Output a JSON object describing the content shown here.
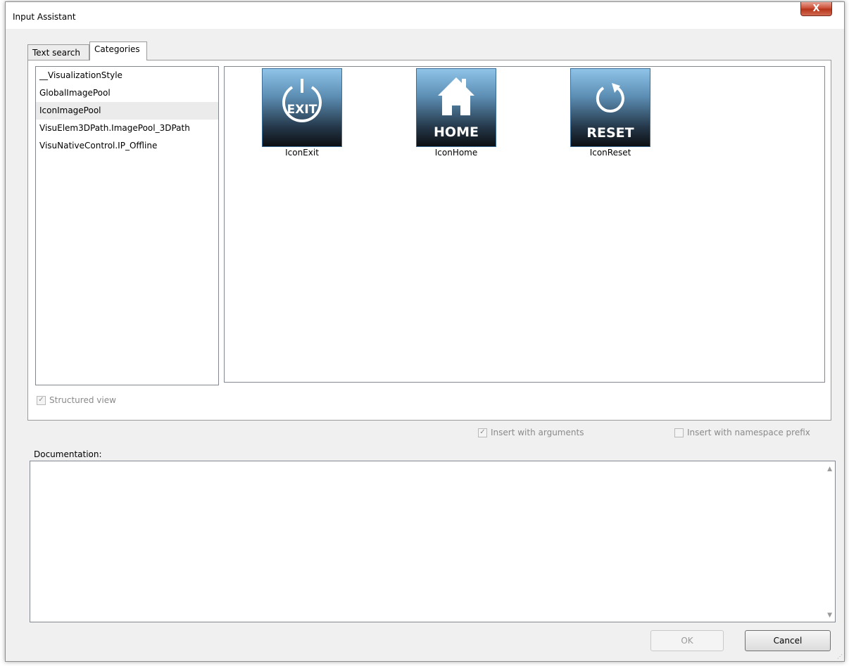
{
  "window": {
    "title": "Input Assistant",
    "close_label": "X"
  },
  "tabs": [
    {
      "label": "Text search",
      "active": false
    },
    {
      "label": "Categories",
      "active": true
    }
  ],
  "categories": [
    {
      "label": "__VisualizationStyle",
      "selected": false
    },
    {
      "label": "GlobalImagePool",
      "selected": false
    },
    {
      "label": "IconImagePool",
      "selected": true
    },
    {
      "label": "VisuElem3DPath.ImagePool_3DPath",
      "selected": false
    },
    {
      "label": "VisuNativeControl.IP_Offline",
      "selected": false
    }
  ],
  "icons": [
    {
      "name": "IconExit",
      "caption": "EXIT",
      "icon": "power-icon"
    },
    {
      "name": "IconHome",
      "caption": "HOME",
      "icon": "house-icon"
    },
    {
      "name": "IconReset",
      "caption": "RESET",
      "icon": "refresh-icon"
    }
  ],
  "options": {
    "structured_view": {
      "label": "Structured view",
      "checked": true,
      "enabled": false
    },
    "insert_with_arguments": {
      "label": "Insert with arguments",
      "checked": true,
      "enabled": false
    },
    "insert_with_namespace_prefix": {
      "label": "Insert with namespace prefix",
      "checked": false,
      "enabled": false
    }
  },
  "documentation": {
    "label": "Documentation:",
    "text": ""
  },
  "buttons": {
    "ok": "OK",
    "cancel": "Cancel"
  },
  "colors": {
    "icon_top": "#8fc3e8",
    "icon_bottom": "#0c0f12",
    "close_button": "#c7462f"
  }
}
